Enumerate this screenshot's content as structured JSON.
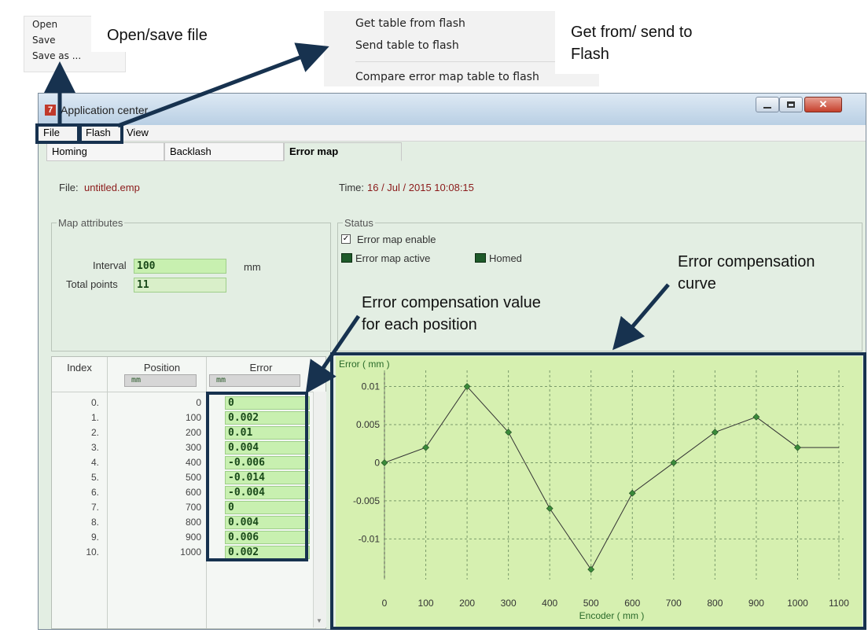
{
  "file_menu": {
    "items": [
      "Open",
      "Save",
      "Save as ..."
    ]
  },
  "flash_menu": {
    "items": [
      "Get table from flash",
      "Send table to flash",
      "Compare error map table to flash"
    ]
  },
  "annotations": {
    "open_save": "Open/save file",
    "flash_line1": "Get from/ send to",
    "flash_line2": "Flash",
    "comp_value_line1": "Error compensation value",
    "comp_value_line2": "for each position",
    "comp_curve_line1": "Error compensation",
    "comp_curve_line2": "curve"
  },
  "window": {
    "title": "Application center",
    "menu": [
      "File",
      "Flash",
      "View"
    ]
  },
  "tabs": [
    "Homing",
    "Backlash",
    "Error map"
  ],
  "file_label": "File:",
  "file_name": "untitled.emp",
  "time_label": "Time:",
  "time_value": "16 / Jul / 2015  10:08:15",
  "map_attributes": {
    "title": "Map attributes",
    "interval_label": "Interval",
    "interval_value": "100",
    "interval_unit": "mm",
    "total_label": "Total points",
    "total_value": "11"
  },
  "status": {
    "title": "Status",
    "enable_label": "Error map enable",
    "enable_checked": true,
    "active_label": "Error map active",
    "homed_label": "Homed"
  },
  "table": {
    "headers": [
      "Index",
      "Position",
      "Error"
    ],
    "units": [
      "mm",
      "mm"
    ],
    "rows": [
      {
        "index": "0.",
        "position": "0",
        "error": "0"
      },
      {
        "index": "1.",
        "position": "100",
        "error": "0.002"
      },
      {
        "index": "2.",
        "position": "200",
        "error": "0.01"
      },
      {
        "index": "3.",
        "position": "300",
        "error": "0.004"
      },
      {
        "index": "4.",
        "position": "400",
        "error": "-0.006"
      },
      {
        "index": "5.",
        "position": "500",
        "error": "-0.014"
      },
      {
        "index": "6.",
        "position": "600",
        "error": "-0.004"
      },
      {
        "index": "7.",
        "position": "700",
        "error": "0"
      },
      {
        "index": "8.",
        "position": "800",
        "error": "0.004"
      },
      {
        "index": "9.",
        "position": "900",
        "error": "0.006"
      },
      {
        "index": "10.",
        "position": "1000",
        "error": "0.002"
      }
    ]
  },
  "chart_data": {
    "type": "line",
    "ylabel": "Error ( mm )",
    "xlabel": "Encoder ( mm )",
    "x": [
      0,
      100,
      200,
      300,
      400,
      500,
      600,
      700,
      800,
      900,
      1000,
      1100
    ],
    "y": [
      0,
      0.002,
      0.01,
      0.004,
      -0.006,
      -0.014,
      -0.004,
      0,
      0.004,
      0.006,
      0.002,
      0.002
    ],
    "marker_count": 11,
    "xticks": [
      "0",
      "100",
      "200",
      "300",
      "400",
      "500",
      "600",
      "700",
      "800",
      "900",
      "1000",
      "1100"
    ],
    "yticks": [
      "0.01",
      "0.005",
      "0",
      "-0.005",
      "-0.01"
    ],
    "ytick_values": [
      0.01,
      0.005,
      0,
      -0.005,
      -0.01
    ],
    "xlim": [
      0,
      1100
    ],
    "ylim": [
      -0.0145,
      0.0115
    ],
    "grid": true,
    "background": "#d6f0b0",
    "line_color": "#333333",
    "marker_color": "#3a8a3a"
  },
  "colors": {
    "highlight": "#17324f",
    "panel_bg": "#e3eee3",
    "field_bg": "#c8f0b0"
  }
}
